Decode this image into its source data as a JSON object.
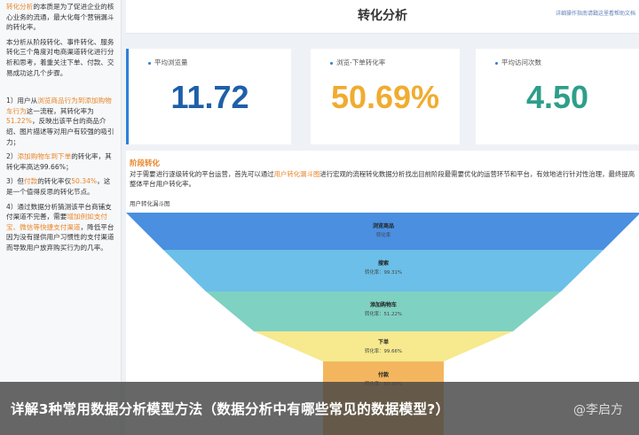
{
  "sidebar": {
    "intro": [
      "转化分析",
      "的本质是为了促进企业的核心业务的流通，最大化每个营销漏斗的转化率。"
    ],
    "para2": "本分析从阶段转化、事件转化、服务转化三个角度对电商渠道转化进行分析和思考，着重关注下单、付款、交易成功这几个步骤。",
    "p1": [
      "1）用户从",
      "浏览商品行为到添加购物车行为",
      "这一流程，其转化率为",
      "51.22%",
      "，反映出该平台的商品介绍、图片描述等对用户有较强的吸引力；"
    ],
    "p2": [
      "2）",
      "添加购物车到下单",
      "的转化率，其转化率高达99.66%；"
    ],
    "p3": [
      "3）但",
      "付款",
      "的转化率仅",
      "50.34%",
      "，这是一个值得反思的转化节点。"
    ],
    "p4": [
      "4）通过数据分析猜测该平台商铺支付渠道不完善，需要",
      "增加例如支付宝、微信等快捷支付渠道",
      "，降低平台因为没有提供用户习惯性的支付渠道而导致用户放弃购买行为的几率。"
    ]
  },
  "header": {
    "title": "转化分析",
    "link": "详细操作指南请戳这里看帮助文档"
  },
  "kpis": [
    {
      "label": "平均浏览量",
      "value": "11.72",
      "color": "#1f5fa8"
    },
    {
      "label": "浏览-下单转化率",
      "value": "50.69%",
      "color": "#f0ac2f"
    },
    {
      "label": "平均访问次数",
      "value": "4.50",
      "color": "#2e9e8a"
    }
  ],
  "stage": {
    "title": "阶段转化",
    "desc": [
      "对于需要进行逐级转化的平台运营，首先可以通过",
      "用户转化漏斗图",
      "进行宏观的流程转化数据分析找出目前阶段最需要优化的运营环节和平台，有效地进行针对性治理，最终提高整体平台用户转化率。"
    ],
    "funnel_label": "用户转化漏斗图"
  },
  "funnel": {
    "stages": [
      {
        "name": "浏览商品",
        "rate": "转化率",
        "color": "#4a8fe0"
      },
      {
        "name": "搜索",
        "rate": "转化率：99.31%",
        "color": "#6bbfe8"
      },
      {
        "name": "添加购物车",
        "rate": "转化率：51.22%",
        "color": "#7fd1c2"
      },
      {
        "name": "下单",
        "rate": "转化率：99.66%",
        "color": "#f6e98e"
      },
      {
        "name": "付款",
        "rate": "转化率：50.34%",
        "color": "#f3b65e"
      }
    ]
  },
  "caption": "详解3种常用数据分析模型方法（数据分析中有哪些常见的数据模型?）",
  "watermark": "@李启方"
}
